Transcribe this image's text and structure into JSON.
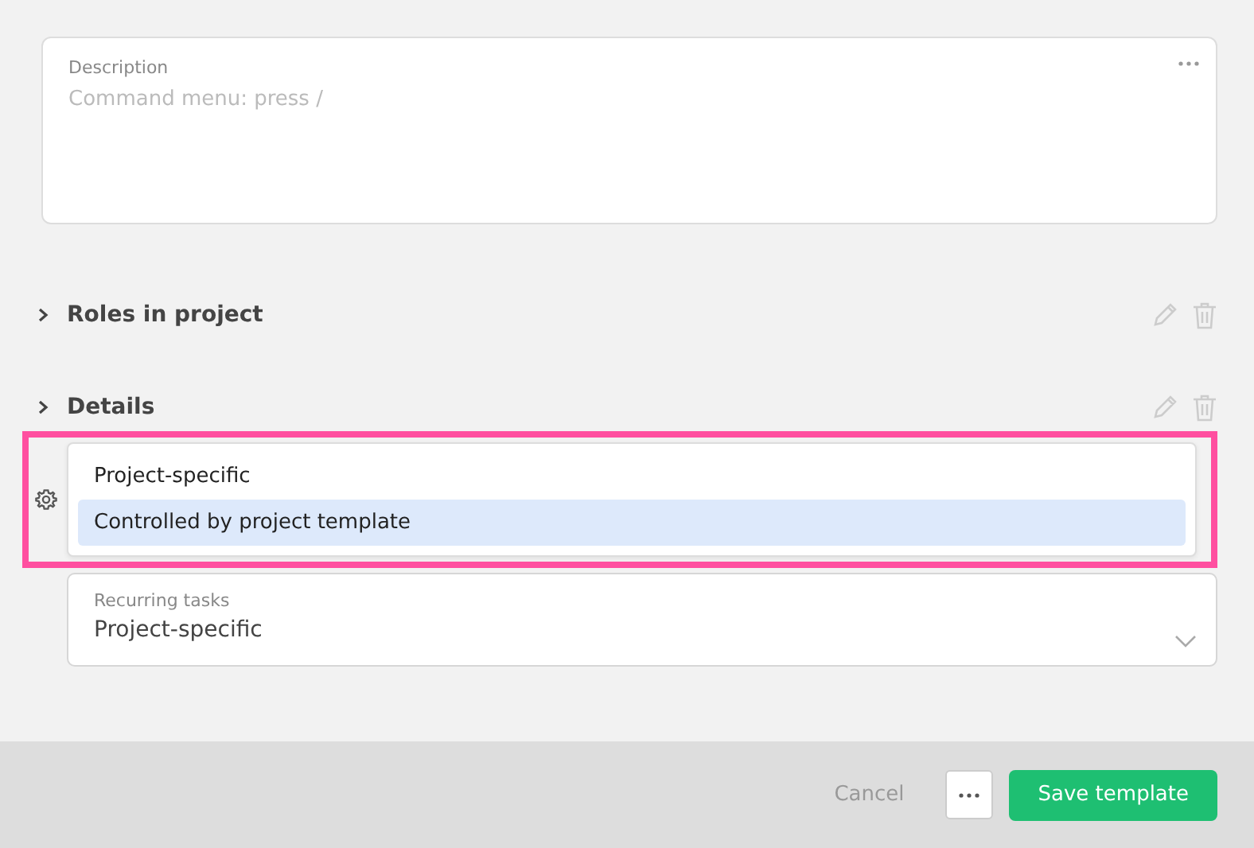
{
  "description": {
    "label": "Description",
    "placeholder": "Command menu: press /"
  },
  "sections": [
    {
      "title": "Roles in project",
      "expanded": false
    },
    {
      "title": "Details",
      "expanded": false
    }
  ],
  "dropdown_menu": {
    "highlighted": true,
    "options": [
      {
        "label": "Project-specific",
        "selected": false
      },
      {
        "label": "Controlled by project template",
        "selected": true
      }
    ]
  },
  "recurring_tasks": {
    "label": "Recurring tasks",
    "value": "Project-specific"
  },
  "footer": {
    "cancel": "Cancel",
    "save": "Save template"
  }
}
